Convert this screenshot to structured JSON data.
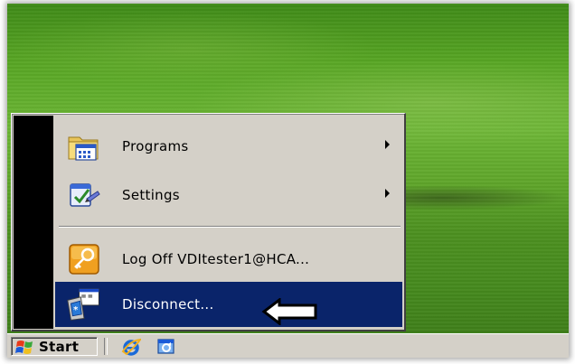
{
  "start_menu": {
    "items": [
      {
        "label": "Programs",
        "icon": "programs-folder-icon",
        "has_submenu": true
      },
      {
        "label": "Settings",
        "icon": "settings-icon",
        "has_submenu": true
      },
      {
        "label": "Log Off VDItester1@HCA...",
        "icon": "key-icon",
        "has_submenu": false
      },
      {
        "label": "Disconnect...",
        "icon": "disconnect-computer-icon",
        "has_submenu": false,
        "highlighted": true
      }
    ]
  },
  "taskbar": {
    "start_label": "Start",
    "quick_launch": [
      {
        "icon": "internet-explorer-icon"
      },
      {
        "icon": "show-desktop-icon"
      }
    ]
  },
  "colors": {
    "highlight": "#0a246a",
    "menu_bg": "#d4d0c8",
    "banner": "#000000"
  }
}
